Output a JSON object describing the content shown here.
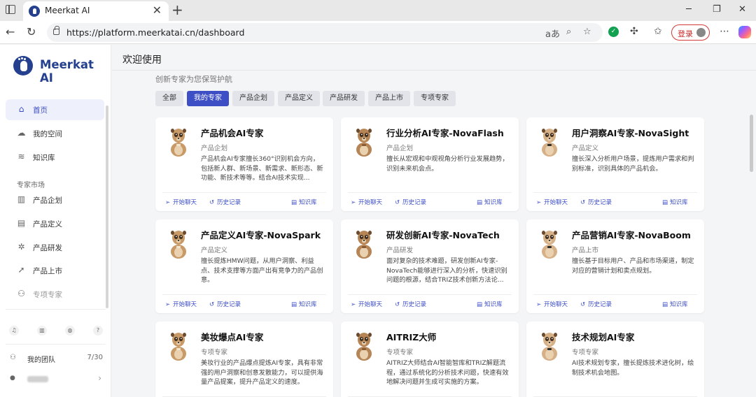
{
  "browser": {
    "tab_title": "Meerkat AI",
    "tab_close": "✕",
    "new_tab": "+",
    "url": "https://platform.meerkatai.cn/dashboard",
    "login_label": "登录",
    "win_min": "─",
    "win_max": "❐",
    "win_close": "✕"
  },
  "sidebar": {
    "logo": "Meerkat AI",
    "top_items": [
      {
        "label": "首页",
        "icon": "home-icon",
        "glyph": "⌂"
      },
      {
        "label": "我的空间",
        "icon": "cloud-icon",
        "glyph": "☁"
      },
      {
        "label": "知识库",
        "icon": "layers-icon",
        "glyph": "≋"
      }
    ],
    "section_label": "专家市场",
    "market_items": [
      {
        "label": "产品企划",
        "icon": "chart-icon",
        "glyph": "▥"
      },
      {
        "label": "产品定义",
        "icon": "document-icon",
        "glyph": "▤"
      },
      {
        "label": "产品研发",
        "icon": "gear-icon",
        "glyph": "✲"
      },
      {
        "label": "产品上市",
        "icon": "rocket-icon",
        "glyph": "➚"
      },
      {
        "label": "专项专家",
        "icon": "people-icon",
        "glyph": "⚇"
      }
    ],
    "bottom_icons": [
      {
        "name": "bell-icon",
        "glyph": "♫"
      },
      {
        "name": "trash-icon",
        "glyph": "▥"
      },
      {
        "name": "wechat-icon",
        "glyph": "◍"
      },
      {
        "name": "help-icon",
        "glyph": "?"
      }
    ],
    "team_label": "我的团队",
    "team_count": "7/30",
    "user_chevron": "›"
  },
  "main": {
    "title": "欢迎使用",
    "subtitle": "创新专家为您保驾护航",
    "filters": [
      "全部",
      "我的专家",
      "产品企划",
      "产品定义",
      "产品研发",
      "产品上市",
      "专项专家"
    ],
    "active_filter": 1,
    "actions": {
      "chat": "开始聊天",
      "history": "历史记录",
      "kb": "知识库"
    },
    "cards": [
      {
        "name": "产品机会AI专家",
        "category": "产品企划",
        "desc": "产品机会AI专家擅长360°识别机会方向，包括新人群、新场景、新需求、新形态、新功能、新技术等等。结合AI技术实现..."
      },
      {
        "name": "行业分析AI专家-NovaFlash",
        "category": "产品企划",
        "desc": "擅长从宏观和中观视角分析行业发展趋势，识别未来机会点。"
      },
      {
        "name": "用户洞察AI专家-NovaSight",
        "category": "产品定义",
        "desc": "擅长深入分析用户场景，提炼用户需求和判别标准，识别具体的产品机会。"
      },
      {
        "name": "产品定义AI专家-NovaSpark",
        "category": "产品定义",
        "desc": "擅长提炼HMW问题，从用户洞察、利益点、技术支撑等方面产出有竞争力的产品创意。"
      },
      {
        "name": "研发创新AI专家-NovaTech",
        "category": "产品研发",
        "desc": "面对复杂的技术难题，研发创新AI专家-NovaTech能够进行深入的分析，快速识别问题的根源，结合TRIZ技术创新方法论..."
      },
      {
        "name": "产品营销AI专家-NovaBoom",
        "category": "产品上市",
        "desc": "擅长基于目标用户、产品和市场渠道，制定对应的营销计划和卖点规划。"
      },
      {
        "name": "美妆爆点AI专家",
        "category": "专项专家",
        "desc": "美妆行业的产品爆点提炼AI专家，具有非常强的用户洞察和创意发散能力，可以提供海量产品提案，提升产品定义的速度。"
      },
      {
        "name": "AITRIZ大师",
        "category": "专项专家",
        "desc": "AITRIZ大师结合AI智能智库和TRIZ解题流程，通过系统化的分析技术问题，快速有效地解决问题并生成可实施的方案。"
      },
      {
        "name": "技术规划AI专家",
        "category": "专项专家",
        "desc": "AI技术规划专家，擅长提炼技术进化树，绘制技术机会地图。"
      }
    ]
  },
  "colors": {
    "brand": "#24408f",
    "accent": "#3e4fc6",
    "login_border": "#d23a3a"
  }
}
